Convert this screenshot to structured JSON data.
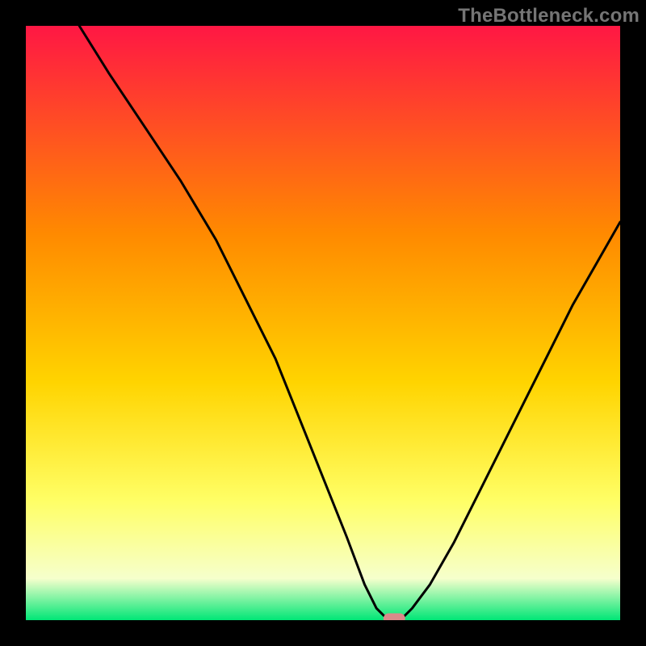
{
  "watermark": "TheBottleneck.com",
  "colors": {
    "bg": "#000000",
    "curve": "#000000",
    "marker_fill": "#d98a8a",
    "marker_stroke": "#d98a8a",
    "gradient_top": "#ff1744",
    "gradient_mid1": "#ff8a00",
    "gradient_mid2": "#ffd400",
    "gradient_mid3": "#ffff66",
    "gradient_mid4": "#f6ffcc",
    "gradient_bottom": "#00e676"
  },
  "chart_data": {
    "type": "line",
    "title": "",
    "xlabel": "",
    "ylabel": "",
    "xlim": [
      0,
      100
    ],
    "ylim": [
      0,
      100
    ],
    "series": [
      {
        "name": "bottleneck-curve",
        "x": [
          9,
          14,
          20,
          26,
          32,
          37,
          42,
          46,
          50,
          54,
          57,
          59,
          61,
          63,
          65,
          68,
          72,
          76,
          80,
          84,
          88,
          92,
          96,
          100
        ],
        "y": [
          100,
          92,
          83,
          74,
          64,
          54,
          44,
          34,
          24,
          14,
          6,
          2,
          0,
          0,
          2,
          6,
          13,
          21,
          29,
          37,
          45,
          53,
          60,
          67
        ]
      }
    ],
    "marker": {
      "x": 62,
      "y": 0
    }
  }
}
